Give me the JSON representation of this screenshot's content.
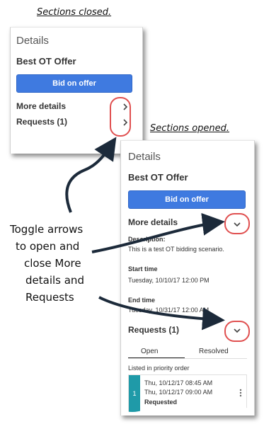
{
  "captions": {
    "closed": "Sections closed.",
    "opened": "Sections opened."
  },
  "closed_panel": {
    "title": "Details",
    "offer_name": "Best OT Offer",
    "bid_button": "Bid on offer",
    "more_details": "More details",
    "requests": "Requests (1)",
    "chevron_icon": "chevron-right-icon"
  },
  "opened_panel": {
    "title": "Details",
    "offer_name": "Best OT Offer",
    "bid_button": "Bid on offer",
    "more_details": "More details",
    "description_label": "Description:",
    "description_value": "This is a test OT bidding scenario.",
    "start_label": "Start time",
    "start_value": "Tuesday, 10/10/17 12:00 PM",
    "end_label": "End time",
    "end_value": "Tuesday, 10/31/17 12:00 AM",
    "requests": "Requests (1)",
    "tabs": [
      "Open",
      "Resolved"
    ],
    "priority_note": "Listed in priority order",
    "request_card": {
      "rank": "1",
      "start": "Thu, 10/12/17 08:45 AM",
      "end": "Thu, 10/12/17 09:00 AM",
      "status": "Requested",
      "menu_icon": "more-vertical-icon"
    },
    "chevron_icon": "chevron-down-icon"
  },
  "annotation": {
    "lines": [
      "Toggle arrows",
      "to open and",
      "close More",
      "details and",
      "Requests"
    ]
  },
  "colors": {
    "button_blue": "#3f7ae0",
    "highlight_red": "#e05050",
    "card_teal": "#1f9aa8"
  }
}
